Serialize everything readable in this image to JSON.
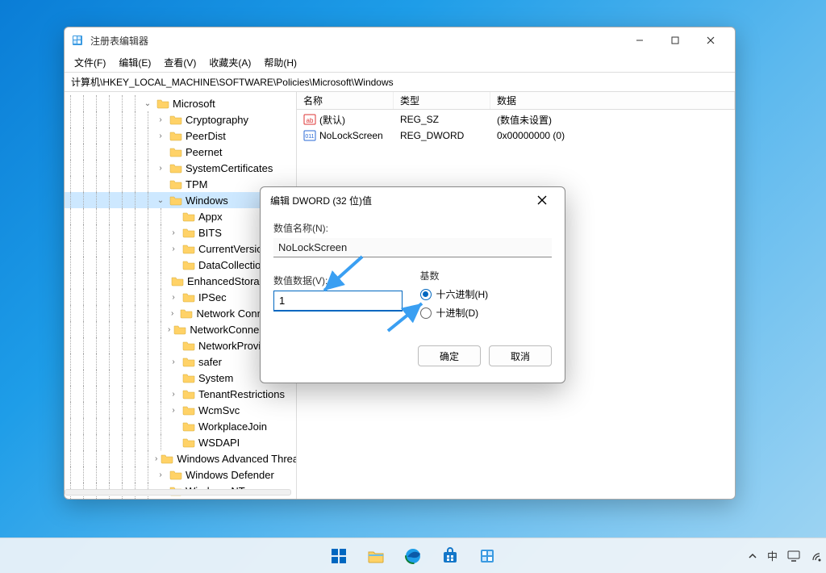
{
  "window": {
    "title": "注册表编辑器",
    "menu": {
      "file": "文件(F)",
      "edit": "编辑(E)",
      "view": "查看(V)",
      "favorites": "收藏夹(A)",
      "help": "帮助(H)"
    },
    "address": "计算机\\HKEY_LOCAL_MACHINE\\SOFTWARE\\Policies\\Microsoft\\Windows"
  },
  "tree": {
    "microsoft": "Microsoft",
    "cryptography": "Cryptography",
    "peerdist": "PeerDist",
    "peernet": "Peernet",
    "systemcerts": "SystemCertificates",
    "tpm": "TPM",
    "windows": "Windows",
    "appx": "Appx",
    "bits": "BITS",
    "currentversion": "CurrentVersion",
    "datacollection": "DataCollection",
    "enhancedstorage": "EnhancedStorageDevices",
    "ipsec": "IPSec",
    "netconnections": "Network Connections",
    "netconnectivity": "NetworkConnectivityStatusIndicator",
    "netprovider": "NetworkProvider",
    "safer": "safer",
    "system": "System",
    "tenantrestrict": "TenantRestrictions",
    "wcmsvc": "WcmSvc",
    "workplacejoin": "WorkplaceJoin",
    "wsdapi": "WSDAPI",
    "winadvthreat": "Windows Advanced Threat Protection",
    "windefender": "Windows Defender",
    "winnt": "Windows NT"
  },
  "list": {
    "col_name": "名称",
    "col_type": "类型",
    "col_data": "数据",
    "rows": [
      {
        "name": "(默认)",
        "type": "REG_SZ",
        "data": "(数值未设置)",
        "kind": "string"
      },
      {
        "name": "NoLockScreen",
        "type": "REG_DWORD",
        "data": "0x00000000 (0)",
        "kind": "dword"
      }
    ]
  },
  "dialog": {
    "title": "编辑 DWORD (32 位)值",
    "label_name": "数值名称(N):",
    "value_name": "NoLockScreen",
    "label_data": "数值数据(V):",
    "value_data": "1",
    "group_base": "基数",
    "radio_hex": "十六进制(H)",
    "radio_dec": "十进制(D)",
    "ok": "确定",
    "cancel": "取消"
  },
  "systray": {
    "ime": "中"
  }
}
